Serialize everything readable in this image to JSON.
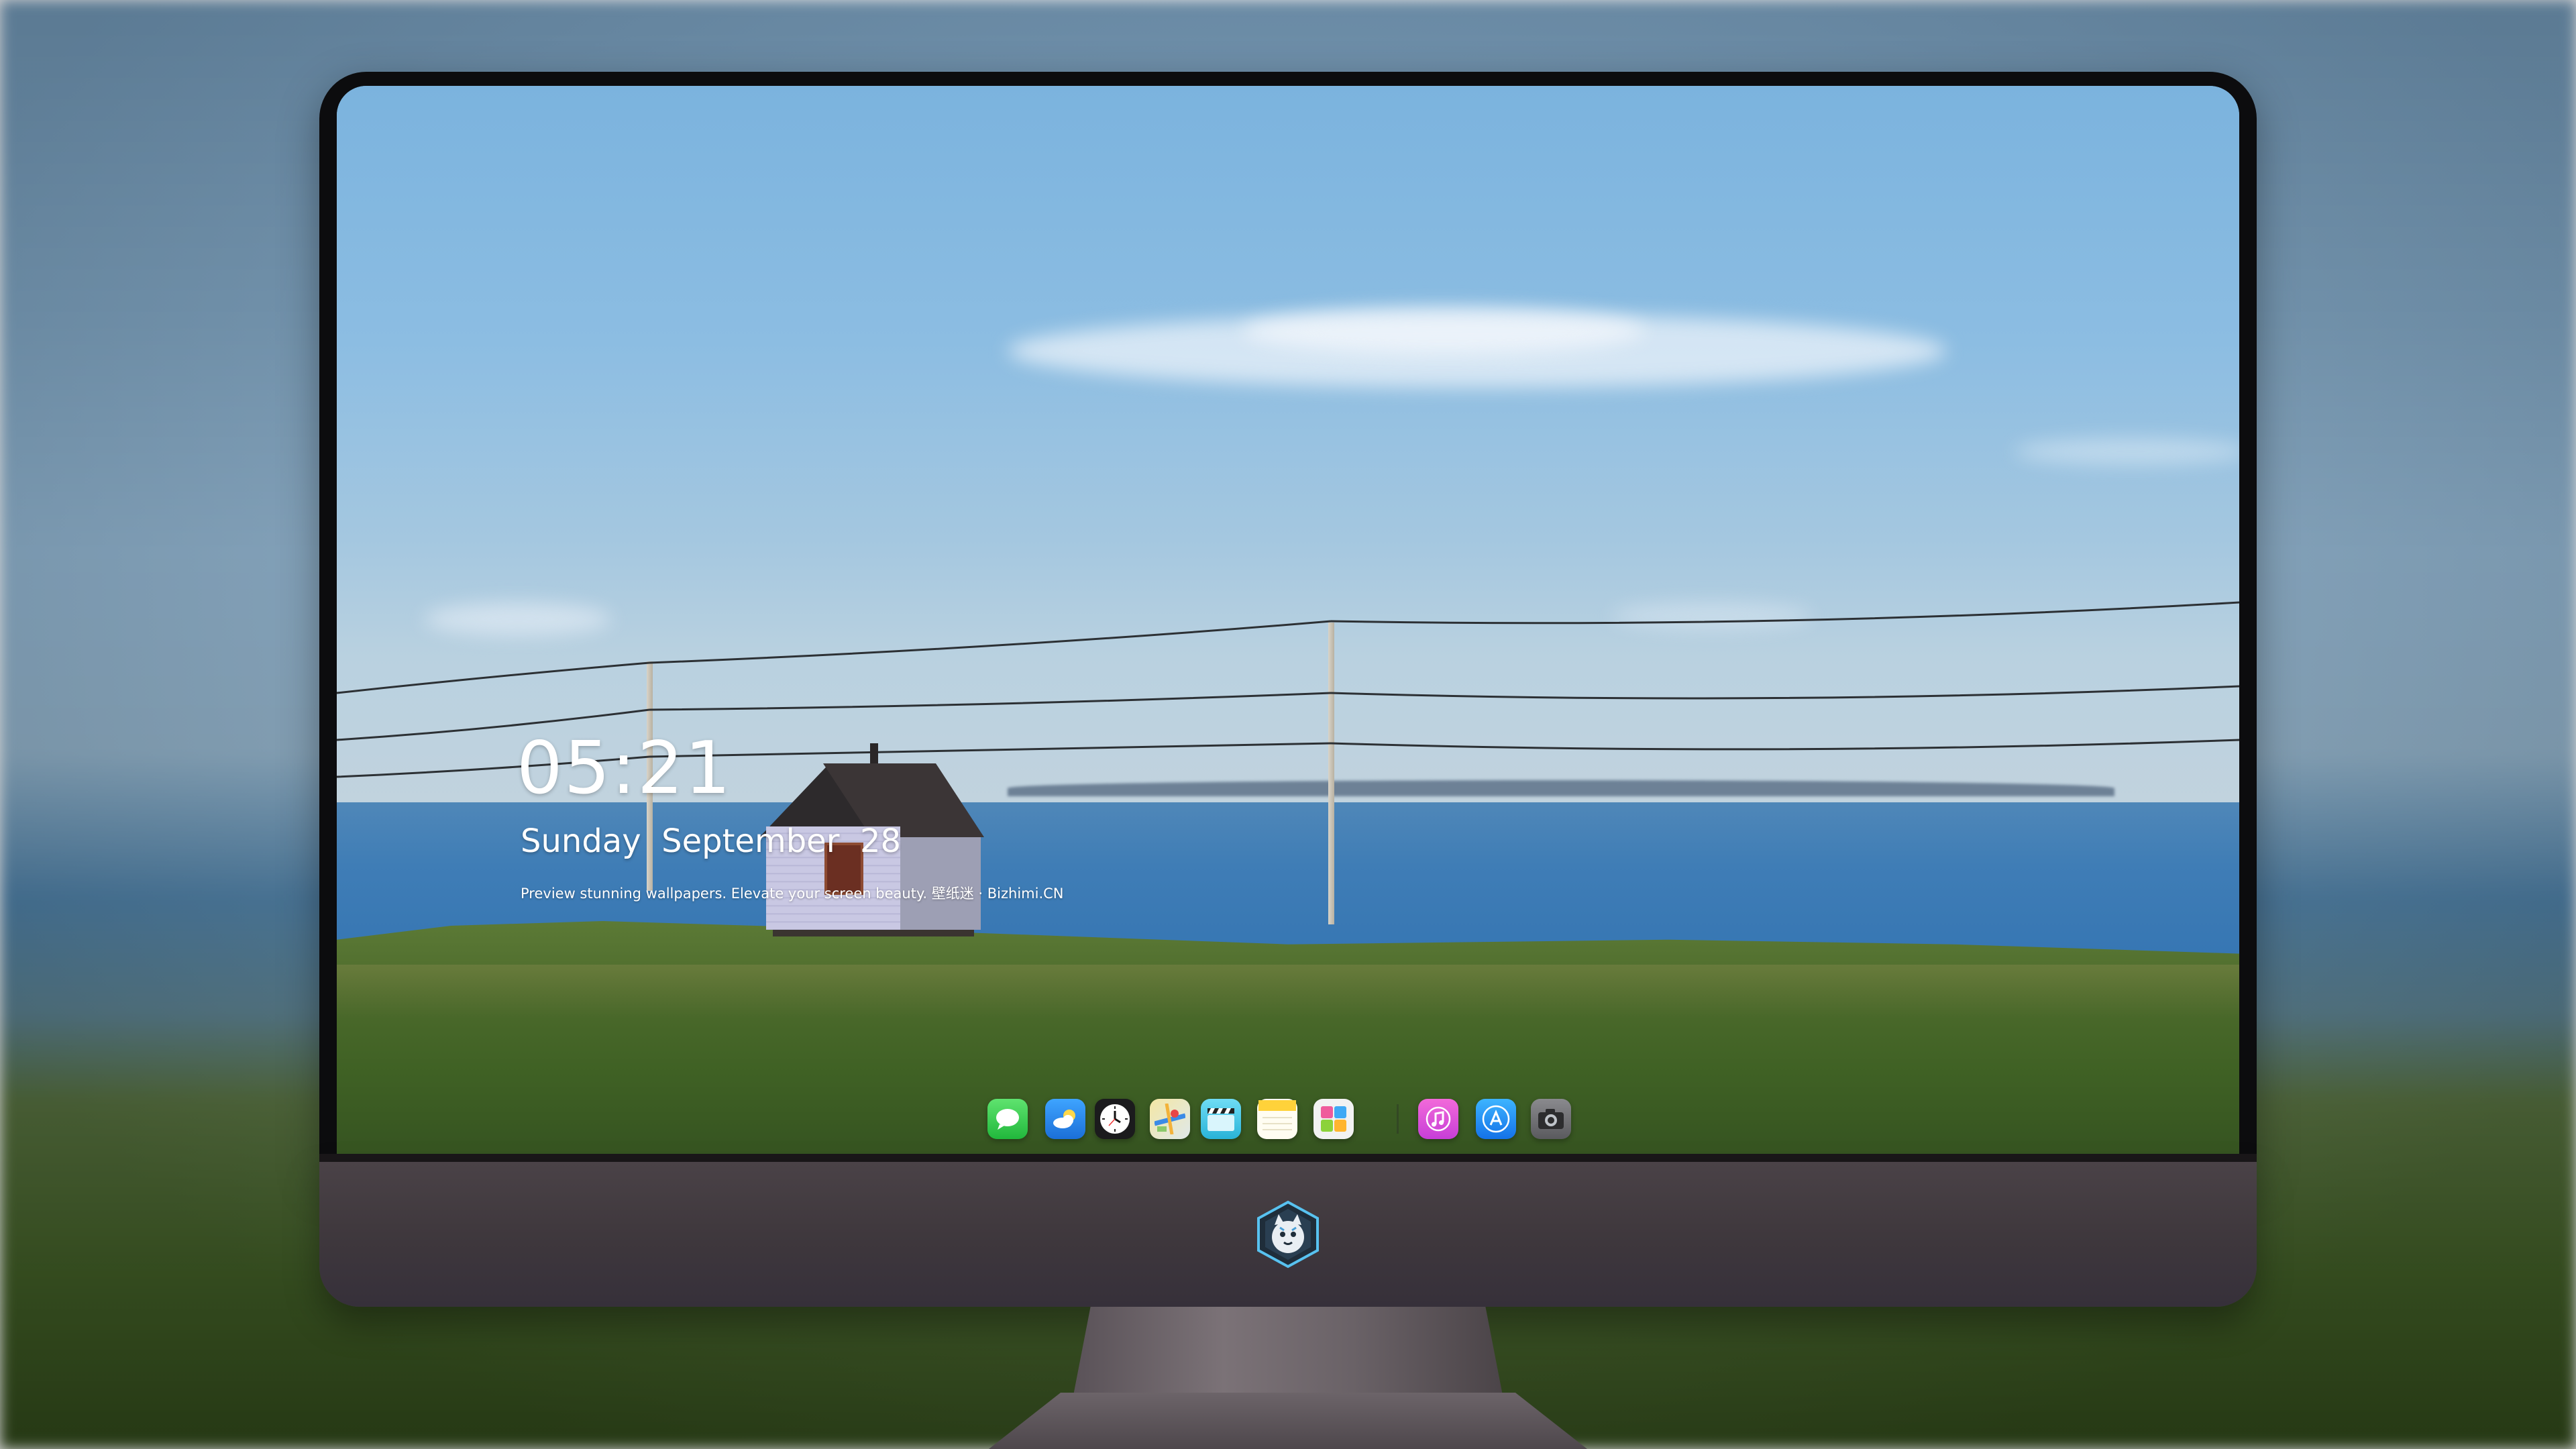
{
  "lockscreen": {
    "time": "05:21",
    "date": "Sunday  September  28",
    "tagline": "Preview stunning wallpapers. Elevate your screen beauty. 壁纸迷 · Bizhimi.CN"
  },
  "dock": {
    "apps": [
      {
        "name": "messages",
        "icon": "message-bubble-icon",
        "color": "#2fcf4f"
      },
      {
        "name": "weather",
        "icon": "weather-cloud-icon",
        "color": "#2b8ef0"
      },
      {
        "name": "clock",
        "icon": "clock-icon",
        "color": "#ffffff"
      },
      {
        "name": "maps",
        "icon": "map-icon",
        "color": "#e9d98a"
      },
      {
        "name": "videos",
        "icon": "clapperboard-icon",
        "color": "#41c8e6"
      },
      {
        "name": "notes",
        "icon": "notes-icon",
        "color": "#ffd23a"
      },
      {
        "name": "game-center",
        "icon": "blocks-icon",
        "color": "#ebebeb"
      },
      {
        "name": "music",
        "icon": "music-note-icon",
        "color": "#e04fd9"
      },
      {
        "name": "app-store",
        "icon": "app-store-icon",
        "color": "#1d86f0"
      },
      {
        "name": "camera",
        "icon": "camera-icon",
        "color": "#6e6e72"
      }
    ]
  },
  "chin": {
    "logo": "tiger-mascot-logo"
  }
}
